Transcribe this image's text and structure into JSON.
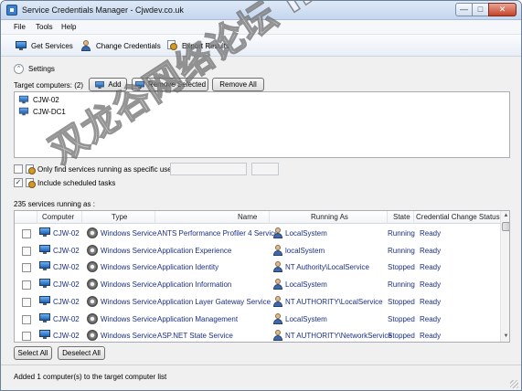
{
  "window": {
    "title": "Service Credentials Manager - Cjwdev.co.uk",
    "minimize_glyph": "—",
    "maximize_glyph": "□",
    "close_glyph": "✕"
  },
  "menu": [
    "File",
    "Tools",
    "Help"
  ],
  "toolbar": {
    "get_services": "Get Services",
    "change_credentials": "Change Credentials",
    "export_results": "Export Results"
  },
  "settings": {
    "label": "Settings",
    "expander_glyph": "⌃"
  },
  "targets": {
    "label": "Target computers: (2)",
    "add_label": "Add",
    "remove_selected_label": "Remove Selected",
    "remove_all_label": "Remove All",
    "computers": [
      "CJW-02",
      "CJW-DC1"
    ]
  },
  "options": {
    "only_find_label": "Only find services running as specific user:",
    "only_find_checked": false,
    "user_value": "",
    "include_scheduled_label": "Include scheduled tasks",
    "include_scheduled_checked": true,
    "check_glyph": "✓"
  },
  "services": {
    "summary": "235 services running as :",
    "columns": [
      "Computer",
      "Type",
      "Name",
      "Running As",
      "State",
      "Credential Change Status"
    ],
    "rows": [
      {
        "computer": "CJW-02",
        "type": "Windows Service",
        "name": "ANTS Performance Profiler 4 Service",
        "running_as": "LocalSystem",
        "state": "Running",
        "status": "Ready"
      },
      {
        "computer": "CJW-02",
        "type": "Windows Service",
        "name": "Application Experience",
        "running_as": "localSystem",
        "state": "Running",
        "status": "Ready"
      },
      {
        "computer": "CJW-02",
        "type": "Windows Service",
        "name": "Application Identity",
        "running_as": "NT Authority\\LocalService",
        "state": "Stopped",
        "status": "Ready"
      },
      {
        "computer": "CJW-02",
        "type": "Windows Service",
        "name": "Application Information",
        "running_as": "LocalSystem",
        "state": "Running",
        "status": "Ready"
      },
      {
        "computer": "CJW-02",
        "type": "Windows Service",
        "name": "Application Layer Gateway Service",
        "running_as": "NT AUTHORITY\\LocalService",
        "state": "Stopped",
        "status": "Ready"
      },
      {
        "computer": "CJW-02",
        "type": "Windows Service",
        "name": "Application Management",
        "running_as": "LocalSystem",
        "state": "Stopped",
        "status": "Ready"
      },
      {
        "computer": "CJW-02",
        "type": "Windows Service",
        "name": "ASP.NET State Service",
        "running_as": "NT AUTHORITY\\NetworkService",
        "state": "Stopped",
        "status": "Ready"
      }
    ],
    "select_all_label": "Select All",
    "deselect_all_label": "Deselect All",
    "scroll_up_glyph": "▲",
    "scroll_down_glyph": "▼"
  },
  "status": {
    "text": "Added 1 computer(s) to the target computer list"
  },
  "watermark": {
    "text": "双龙谷网络论坛 http://31.to"
  }
}
